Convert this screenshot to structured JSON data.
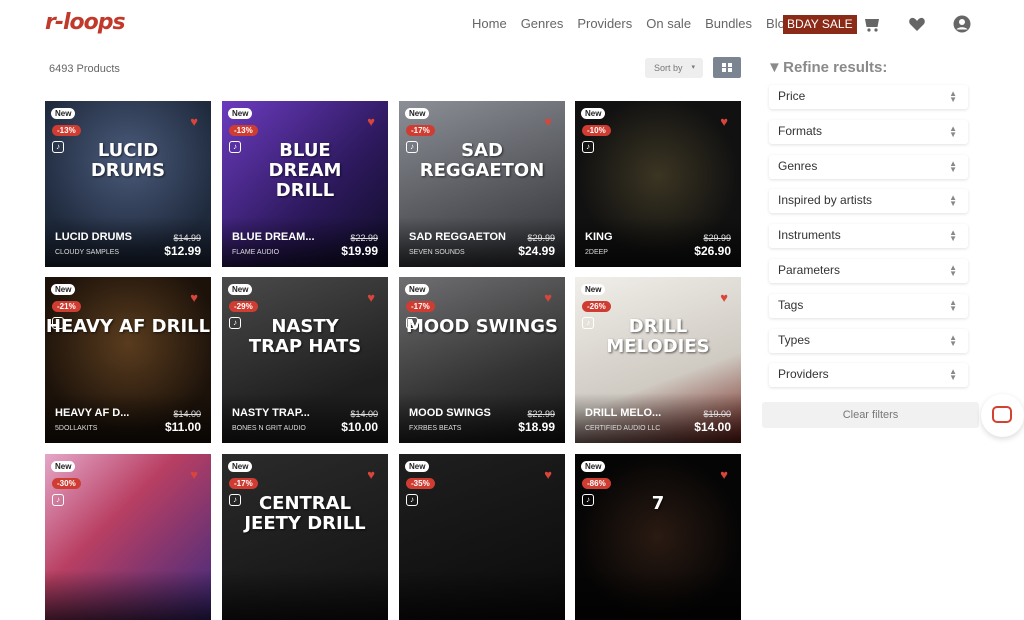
{
  "header": {
    "logo": "r-loops",
    "nav": [
      "Home",
      "Genres",
      "Providers",
      "On sale",
      "Bundles",
      "Blog"
    ],
    "sale_button": "BDAY SALE",
    "icons": [
      "cart-icon",
      "heart-icon",
      "account-icon"
    ]
  },
  "toolbar": {
    "product_count": "6493 Products",
    "sort_label": "Sort by",
    "view_toggle_icon": "grid-icon"
  },
  "products": [
    {
      "badge": "New",
      "discount": "-13%",
      "title": "LUCID DRUMS",
      "brand": "CLOUDY SAMPLES",
      "old_price": "$14.99",
      "price": "$12.99",
      "art_text": "LUCID\nDRUMS"
    },
    {
      "badge": "New",
      "discount": "-13%",
      "title": "BLUE DREAM...",
      "brand": "FLAME AUDIO",
      "old_price": "$22.99",
      "price": "$19.99",
      "art_text": "BLUE\nDREAM\nDRILL"
    },
    {
      "badge": "New",
      "discount": "-17%",
      "title": "SAD REGGAETON",
      "brand": "SEVEN SOUNDS",
      "old_price": "$29.99",
      "price": "$24.99",
      "art_text": "SAD\nREGGAETON"
    },
    {
      "badge": "New",
      "discount": "-10%",
      "title": "KING",
      "brand": "2DEEP",
      "old_price": "$29.99",
      "price": "$26.90",
      "art_text": ""
    },
    {
      "badge": "New",
      "discount": "-21%",
      "title": "HEAVY AF D...",
      "brand": "5DOLLAKITS",
      "old_price": "$14.00",
      "price": "$11.00",
      "art_text": "HEAVY AF DRILL"
    },
    {
      "badge": "New",
      "discount": "-29%",
      "title": "NASTY TRAP...",
      "brand": "BONES N GRIT AUDIO",
      "old_price": "$14.00",
      "price": "$10.00",
      "art_text": "NASTY\nTRAP HATS"
    },
    {
      "badge": "New",
      "discount": "-17%",
      "title": "MOOD SWINGS",
      "brand": "FXRBES BEATS",
      "old_price": "$22.99",
      "price": "$18.99",
      "art_text": "MOOD SWINGS"
    },
    {
      "badge": "New",
      "discount": "-26%",
      "title": "DRILL MELO...",
      "brand": "CERTIFIED AUDIO LLC",
      "old_price": "$19.00",
      "price": "$14.00",
      "art_text": "DRILL\nMELODIES"
    },
    {
      "badge": "New",
      "discount": "-30%",
      "title": "",
      "brand": "",
      "old_price": "",
      "price": "",
      "art_text": ""
    },
    {
      "badge": "New",
      "discount": "-17%",
      "title": "",
      "brand": "",
      "old_price": "",
      "price": "",
      "art_text": "CENTRAL\nJEETY DRILL"
    },
    {
      "badge": "New",
      "discount": "-35%",
      "title": "",
      "brand": "",
      "old_price": "",
      "price": "",
      "art_text": ""
    },
    {
      "badge": "New",
      "discount": "-86%",
      "title": "",
      "brand": "",
      "old_price": "",
      "price": "",
      "art_text": "7"
    }
  ],
  "sidebar": {
    "title": "Refine results:",
    "filters": [
      "Price",
      "Formats",
      "Genres",
      "Inspired by artists",
      "Instruments",
      "Parameters",
      "Tags",
      "Types",
      "Providers"
    ],
    "clear_label": "Clear filters"
  },
  "colors": {
    "accent": "#cf3d32",
    "sale": "#8b2a17",
    "filter_text": "#333333"
  }
}
